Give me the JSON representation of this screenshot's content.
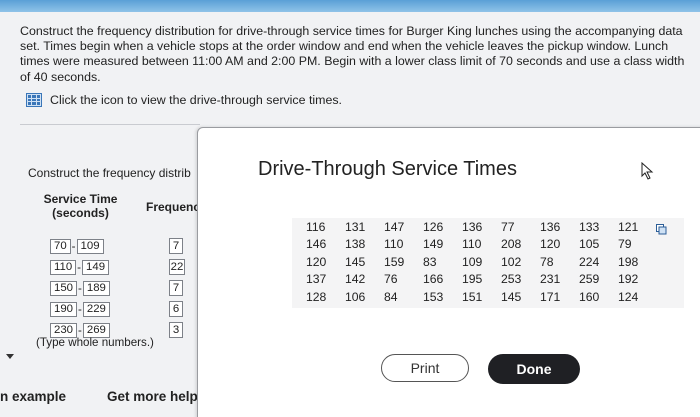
{
  "question": {
    "text": "Construct the frequency distribution for drive-through service times for Burger King lunches using the accompanying data set. Times begin when a vehicle stops at the order window and end when the vehicle leaves the pickup window. Lunch times were measured between 11:00 AM and 2:00 PM. Begin with a lower class limit of 70 seconds and use a class width of 40 seconds.",
    "data_link": "Click the icon to view the drive-through service times."
  },
  "freq_section": {
    "title": "Construct the frequency distrib",
    "col_service": "Service Time (seconds)",
    "col_frequency": "Frequenc",
    "rows": [
      {
        "lower": "70",
        "upper": "109",
        "freq": "7"
      },
      {
        "lower": "110",
        "upper": "149",
        "freq": "22"
      },
      {
        "lower": "150",
        "upper": "189",
        "freq": "7"
      },
      {
        "lower": "190",
        "upper": "229",
        "freq": "6"
      },
      {
        "lower": "230",
        "upper": "269",
        "freq": "3"
      }
    ],
    "dash": "-",
    "note": "(Type whole numbers.)"
  },
  "bottom": {
    "example": "n example",
    "help": "Get more help"
  },
  "modal": {
    "title": "Drive-Through Service Times",
    "rows": [
      [
        "116",
        "131",
        "147",
        "126",
        "136",
        "77",
        "136",
        "133",
        "121"
      ],
      [
        "146",
        "138",
        "110",
        "149",
        "110",
        "208",
        "120",
        "105",
        "79"
      ],
      [
        "120",
        "145",
        "159",
        "83",
        "109",
        "102",
        "78",
        "224",
        "198"
      ],
      [
        "137",
        "142",
        "76",
        "166",
        "195",
        "253",
        "231",
        "259",
        "192"
      ],
      [
        "128",
        "106",
        "84",
        "153",
        "151",
        "145",
        "171",
        "160",
        "124"
      ]
    ],
    "print_label": "Print",
    "done_label": "Done"
  },
  "colors": {
    "accent": "#3a76b8",
    "done_button": "#1f2024",
    "top_strip": "#5aa0d6"
  },
  "icons": [
    "data-table-icon",
    "cursor-icon",
    "copy-icon",
    "chevron-down-icon"
  ]
}
